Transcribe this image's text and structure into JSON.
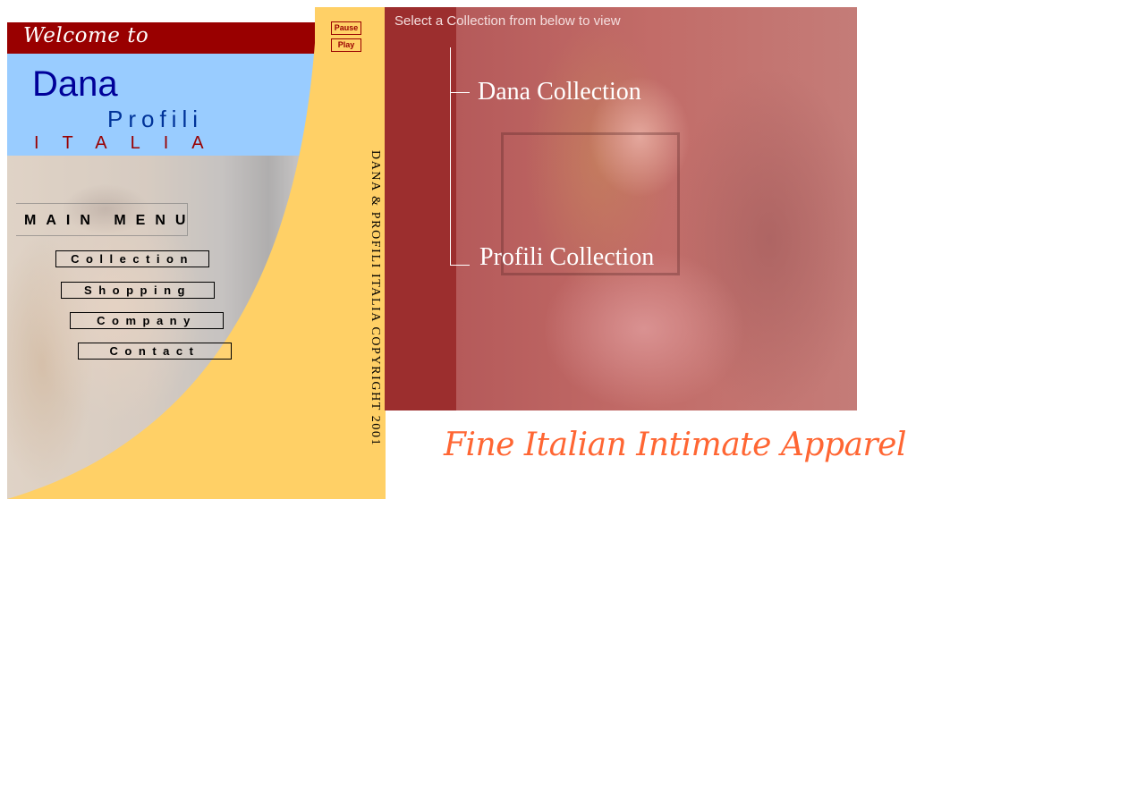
{
  "left_panel": {
    "welcome": "Welcome to",
    "logo": {
      "dana": "Dana",
      "profili": "Profili",
      "italia": "ITALIA"
    },
    "menu_title": "MAIN MENU",
    "menu_items": [
      {
        "label": "Collection"
      },
      {
        "label": "Shopping"
      },
      {
        "label": "Company"
      },
      {
        "label": "Contact"
      }
    ],
    "controls": {
      "pause": "Pause",
      "play": "Play"
    },
    "copyright": "DANA & PROFILI ITALIA COPYRIGHT 2001"
  },
  "right_panel": {
    "instruction": "Select a Collection from below to view",
    "collections": [
      {
        "label": "Dana Collection"
      },
      {
        "label": "Profili Collection"
      }
    ]
  },
  "tagline": "Fine Italian Intimate Apparel",
  "colors": {
    "welcome_bar": "#990000",
    "logo_background": "#99ccff",
    "panel_yellow": "#ffd066",
    "tagline": "#ff6633",
    "right_panel_tint": "#a33a3a"
  }
}
